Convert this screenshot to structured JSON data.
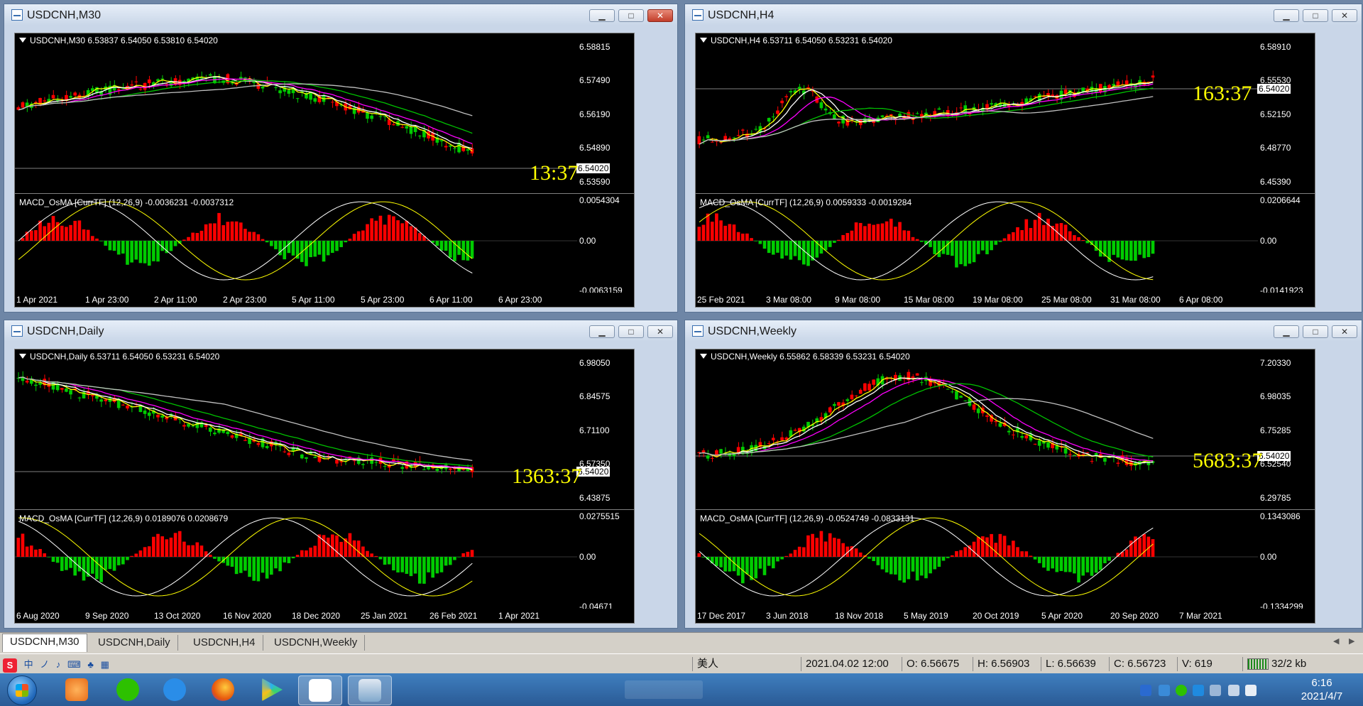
{
  "windows": [
    {
      "title": "USDCNH,M30",
      "close_active": true,
      "header": "USDCNH,M30  6.53837 6.54050 6.53810 6.54020",
      "price_labels": [
        "6.58815",
        "6.57490",
        "6.56190",
        "6.54890",
        "6.53590"
      ],
      "current_price": "6.54020",
      "countdown": "13:37",
      "indicator_header": "MACD_OsMA [CurrTF] (12,26,9) -0.0036231 -0.0037312",
      "indicator_labels": [
        "0.0054304",
        "0.00",
        "-0.0063159"
      ],
      "time_labels": [
        "1 Apr 2021",
        "1 Apr 23:00",
        "2 Apr 11:00",
        "2 Apr 23:00",
        "5 Apr 11:00",
        "5 Apr 23:00",
        "6 Apr 11:00",
        "6 Apr 23:00"
      ]
    },
    {
      "title": "USDCNH,H4",
      "close_active": false,
      "header": "USDCNH,H4  6.53711 6.54050 6.53231 6.54020",
      "price_labels": [
        "6.58910",
        "6.55530",
        "6.52150",
        "6.48770",
        "6.45390"
      ],
      "current_price": "6.54020",
      "countdown": "163:37",
      "indicator_header": "MACD_OsMA [CurrTF] (12,26,9) 0.0059333 -0.0019284",
      "indicator_labels": [
        "0.0206644",
        "0.00",
        "-0.0141923"
      ],
      "time_labels": [
        "25 Feb 2021",
        "3 Mar 08:00",
        "9 Mar 08:00",
        "15 Mar 08:00",
        "19 Mar 08:00",
        "25 Mar 08:00",
        "31 Mar 08:00",
        "6 Apr 08:00"
      ]
    },
    {
      "title": "USDCNH,Daily",
      "close_active": false,
      "header": "USDCNH,Daily  6.53711 6.54050 6.53231 6.54020",
      "price_labels": [
        "6.98050",
        "6.84575",
        "6.71100",
        "6.57350",
        "6.43875"
      ],
      "current_price": "6.54020",
      "countdown": "1363:37",
      "indicator_header": "MACD_OsMA [CurrTF] (12,26,9) 0.0189076 0.0208679",
      "indicator_labels": [
        "0.0275515",
        "0.00",
        "-0.04671"
      ],
      "time_labels": [
        "6 Aug 2020",
        "9 Sep 2020",
        "13 Oct 2020",
        "16 Nov 2020",
        "18 Dec 2020",
        "25 Jan 2021",
        "26 Feb 2021",
        "1 Apr 2021"
      ]
    },
    {
      "title": "USDCNH,Weekly",
      "close_active": false,
      "header": "USDCNH,Weekly  6.55862 6.58339 6.53231 6.54020",
      "price_labels": [
        "7.20330",
        "6.98035",
        "6.75285",
        "6.52540",
        "6.29785"
      ],
      "current_price": "6.54020",
      "countdown": "5683:37",
      "indicator_header": "MACD_OsMA [CurrTF] (12,26,9) -0.0524749 -0.0833131",
      "indicator_labels": [
        "0.1343086",
        "0.00",
        "-0.1334299"
      ],
      "time_labels": [
        "17 Dec 2017",
        "3 Jun 2018",
        "18 Nov 2018",
        "5 May 2019",
        "20 Oct 2019",
        "5 Apr 2020",
        "20 Sep 2020",
        "7 Mar 2021"
      ]
    }
  ],
  "tabs": [
    "USDCNH,M30",
    "USDCNH,Daily",
    "USDCNH,H4",
    "USDCNH,Weekly"
  ],
  "active_tab": "USDCNH,M30",
  "status": {
    "profile": "美人",
    "datetime": "2021.04.02 12:00",
    "open": "O: 6.56675",
    "high": "H: 6.56903",
    "low": "L: 6.56639",
    "close": "C: 6.56723",
    "volume": "V: 619",
    "traffic": "32/2 kb"
  },
  "ime": {
    "mode": "中"
  },
  "clock": {
    "time": "6:16",
    "date": "2021/4/7"
  },
  "colors": {
    "bull": "#00cc00",
    "bear": "#ff0000",
    "countdown": "#ffff00",
    "ma_fast": "#ffff00",
    "ma_mid": "#ffffff",
    "ma_slow1": "#ff00ff",
    "ma_slow2": "#00c000",
    "ma_slow3": "#c0c0c0"
  },
  "icons": {
    "window_icon": "chart-window-icon",
    "minimize": "minimize-icon",
    "maximize": "maximize-icon",
    "close": "close-icon"
  }
}
